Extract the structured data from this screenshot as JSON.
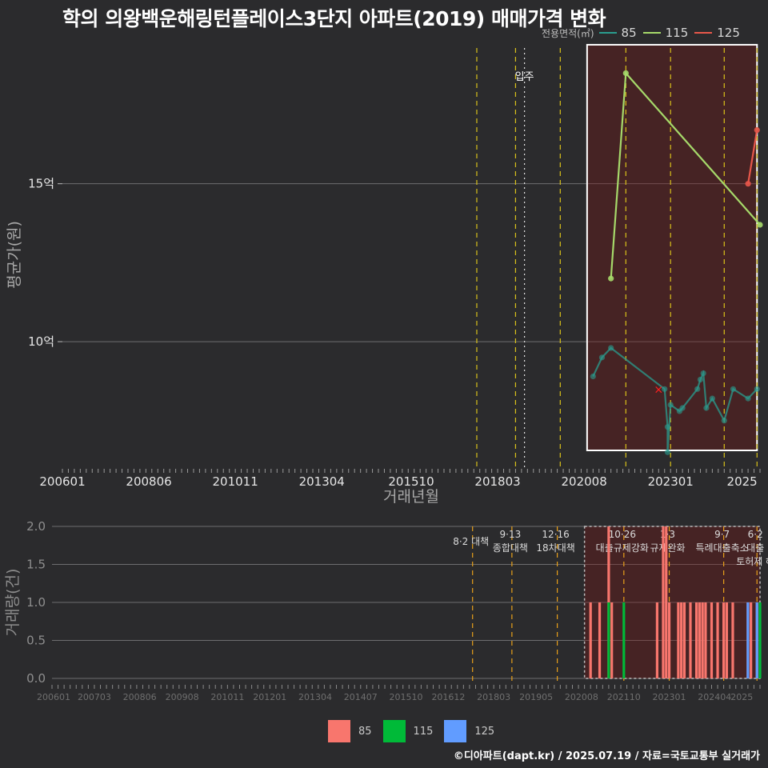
{
  "title": "학의 의왕백운해링턴플레이스3단지 아파트(2019) 매매가격 변화",
  "legend": {
    "title": "전용면적(㎡)",
    "items": [
      {
        "label": "85",
        "color": "#2a9d8f"
      },
      {
        "label": "115",
        "color": "#a6d96a"
      },
      {
        "label": "125",
        "color": "#e8574a"
      }
    ]
  },
  "bottom_legend": {
    "items": [
      {
        "label": "85",
        "color": "#f8766d"
      },
      {
        "label": "115",
        "color": "#00ba38"
      },
      {
        "label": "125",
        "color": "#619cff"
      }
    ]
  },
  "footer": "©디아파트(dapt.kr) / 2025.07.19 / 자료=국토교통부 실거래가",
  "chart_data": [
    {
      "type": "line",
      "xlabel": "거래년월",
      "ylabel": "평균가(원)",
      "x_range": [
        "2006-01",
        "2025-07"
      ],
      "y_range": [
        6.0,
        19.5
      ],
      "y_ticks": [
        {
          "value": 10,
          "label": "10억"
        },
        {
          "value": 15,
          "label": "15억"
        }
      ],
      "x_ticks": [
        "200601",
        "200806",
        "201011",
        "201304",
        "201510",
        "201803",
        "202008",
        "202301",
        "2025"
      ],
      "grid": true,
      "highlight_box": {
        "from": "2020-09",
        "to": "2025-06"
      },
      "policy_lines": [
        "2017-08",
        "2018-09",
        "2019-12",
        "2021-10",
        "2023-01",
        "2024-07",
        "2025-06"
      ],
      "move_in": {
        "date": "2018-12",
        "label": "입주"
      },
      "series": [
        {
          "name": "85",
          "color": "#2a9d8f",
          "points": [
            {
              "x": "2020-11",
              "y": 8.9
            },
            {
              "x": "2021-02",
              "y": 9.5
            },
            {
              "x": "2021-05",
              "y": 9.8
            },
            {
              "x": "2022-11",
              "y": 8.5
            },
            {
              "x": "2022-12",
              "y": 7.3
            },
            {
              "x": "2022-12",
              "y": 6.5
            },
            {
              "x": "2023-01",
              "y": 8.0
            },
            {
              "x": "2023-04",
              "y": 7.8
            },
            {
              "x": "2023-05",
              "y": 7.9
            },
            {
              "x": "2023-10",
              "y": 8.5
            },
            {
              "x": "2023-11",
              "y": 8.8
            },
            {
              "x": "2023-12",
              "y": 9.0
            },
            {
              "x": "2024-01",
              "y": 7.9
            },
            {
              "x": "2024-03",
              "y": 8.2
            },
            {
              "x": "2024-07",
              "y": 7.5
            },
            {
              "x": "2024-10",
              "y": 8.5
            },
            {
              "x": "2025-03",
              "y": 8.2
            },
            {
              "x": "2025-06",
              "y": 8.5
            }
          ]
        },
        {
          "name": "115",
          "color": "#a6d96a",
          "points": [
            {
              "x": "2021-05",
              "y": 12.0
            },
            {
              "x": "2021-10",
              "y": 18.5
            },
            {
              "x": "2025-07",
              "y": 13.7
            }
          ]
        },
        {
          "name": "125",
          "color": "#e8574a",
          "points": [
            {
              "x": "2025-03",
              "y": 15.0
            },
            {
              "x": "2025-06",
              "y": 16.7
            }
          ]
        }
      ],
      "cancelled": [
        {
          "x": "2022-09",
          "y": 8.5,
          "label": "×"
        }
      ]
    },
    {
      "type": "bar",
      "ylabel": "거래량(건)",
      "y_range": [
        0,
        2.0
      ],
      "y_ticks": [
        "0.0",
        "0.5",
        "1.0",
        "1.5",
        "2.0"
      ],
      "x_ticks": [
        "200601",
        "200703",
        "200806",
        "200908",
        "201011",
        "201201",
        "201304",
        "201407",
        "201510",
        "201612",
        "201803",
        "201905",
        "202008",
        "202110",
        "202301",
        "202404",
        "2025"
      ],
      "highlight_box": {
        "from": "2020-09",
        "to": "2025-07"
      },
      "policy_labels": [
        {
          "date": "2017-08",
          "lines": [
            "8·2 대책"
          ]
        },
        {
          "date": "2018-09",
          "lines": [
            "9·13",
            "종합대책"
          ]
        },
        {
          "date": "2019-12",
          "lines": [
            "12·16",
            "18차대책"
          ]
        },
        {
          "date": "2021-10",
          "lines": [
            "10·26",
            "대출규제강화"
          ]
        },
        {
          "date": "2023-01",
          "lines": [
            "1·3",
            "규제완화"
          ]
        },
        {
          "date": "2024-07",
          "lines": [
            "9·7",
            "특례대출축소"
          ]
        },
        {
          "date": "2025-06",
          "lines": [
            "6·2",
            "대출",
            "토허제 해"
          ]
        }
      ],
      "series": [
        {
          "name": "85",
          "color": "#f8766d",
          "bars": [
            {
              "x": "2020-11",
              "y": 1
            },
            {
              "x": "2021-02",
              "y": 1
            },
            {
              "x": "2021-05",
              "y": 2
            },
            {
              "x": "2021-06",
              "y": 1
            },
            {
              "x": "2022-09",
              "y": 1
            },
            {
              "x": "2022-11",
              "y": 2
            },
            {
              "x": "2022-12",
              "y": 2
            },
            {
              "x": "2023-01",
              "y": 1
            },
            {
              "x": "2023-04",
              "y": 1
            },
            {
              "x": "2023-05",
              "y": 1
            },
            {
              "x": "2023-06",
              "y": 1
            },
            {
              "x": "2023-08",
              "y": 1
            },
            {
              "x": "2023-10",
              "y": 1
            },
            {
              "x": "2023-11",
              "y": 1
            },
            {
              "x": "2023-12",
              "y": 1
            },
            {
              "x": "2024-01",
              "y": 1
            },
            {
              "x": "2024-03",
              "y": 1
            },
            {
              "x": "2024-05",
              "y": 1
            },
            {
              "x": "2024-07",
              "y": 1
            },
            {
              "x": "2024-08",
              "y": 1
            },
            {
              "x": "2024-10",
              "y": 1
            },
            {
              "x": "2025-03",
              "y": 1
            },
            {
              "x": "2025-04",
              "y": 1
            },
            {
              "x": "2025-06",
              "y": 1
            }
          ]
        },
        {
          "name": "115",
          "color": "#00ba38",
          "bars": [
            {
              "x": "2021-05",
              "y": 1
            },
            {
              "x": "2021-10",
              "y": 1
            },
            {
              "x": "2025-07",
              "y": 1
            }
          ]
        },
        {
          "name": "125",
          "color": "#619cff",
          "bars": [
            {
              "x": "2025-03",
              "y": 1
            },
            {
              "x": "2025-06",
              "y": 1
            }
          ]
        }
      ]
    }
  ]
}
